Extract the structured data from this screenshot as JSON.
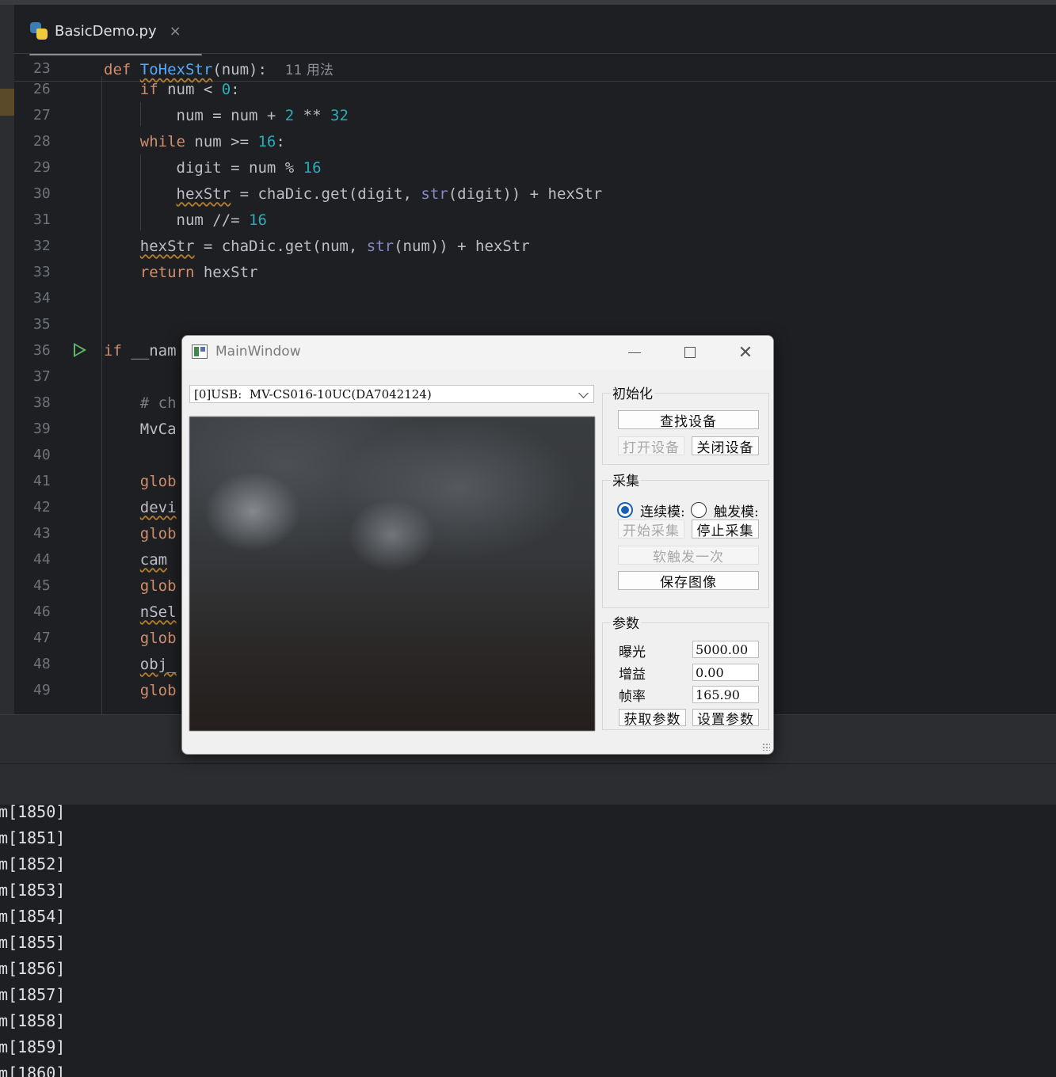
{
  "ide": {
    "tab_label": "BasicDemo.py",
    "tab_close": "×",
    "sticky_line": {
      "num": "23",
      "def": "def",
      "name": "ToHexStr",
      "rest": "(num):",
      "hint": "11 用法"
    },
    "code_lines": [
      {
        "num": "26",
        "tokens": [
          [
            "kw",
            "    if "
          ],
          [
            "plain",
            "num < "
          ],
          [
            "num",
            "0"
          ],
          [
            "plain",
            ":"
          ]
        ]
      },
      {
        "num": "27",
        "tokens": [
          [
            "plain",
            "        num = num + "
          ],
          [
            "num",
            "2"
          ],
          [
            "plain",
            " ** "
          ],
          [
            "num",
            "32"
          ]
        ]
      },
      {
        "num": "28",
        "tokens": [
          [
            "kw",
            "    while "
          ],
          [
            "plain",
            "num >= "
          ],
          [
            "num",
            "16"
          ],
          [
            "plain",
            ":"
          ]
        ]
      },
      {
        "num": "29",
        "tokens": [
          [
            "plain",
            "        digit = num % "
          ],
          [
            "num",
            "16"
          ]
        ]
      },
      {
        "num": "30",
        "tokens": [
          [
            "plain",
            "        "
          ],
          [
            "uw",
            "hexStr"
          ],
          [
            "plain",
            " = chaDic.get(digit, "
          ],
          [
            "bi",
            "str"
          ],
          [
            "plain",
            "(digit)) + hexStr"
          ]
        ]
      },
      {
        "num": "31",
        "tokens": [
          [
            "plain",
            "        num //= "
          ],
          [
            "num",
            "16"
          ]
        ]
      },
      {
        "num": "32",
        "tokens": [
          [
            "plain",
            "    "
          ],
          [
            "uw",
            "hexStr"
          ],
          [
            "plain",
            " = chaDic.get(num, "
          ],
          [
            "bi",
            "str"
          ],
          [
            "plain",
            "(num)) + hexStr"
          ]
        ]
      },
      {
        "num": "33",
        "tokens": [
          [
            "kw",
            "    return "
          ],
          [
            "plain",
            "hexStr"
          ]
        ]
      },
      {
        "num": "34",
        "tokens": []
      },
      {
        "num": "35",
        "tokens": []
      },
      {
        "num": "36",
        "tokens": [
          [
            "kw",
            "if "
          ],
          [
            "plain",
            "__nam"
          ]
        ]
      },
      {
        "num": "37",
        "tokens": []
      },
      {
        "num": "38",
        "tokens": [
          [
            "hintc",
            "    # ch"
          ]
        ]
      },
      {
        "num": "39",
        "tokens": [
          [
            "plain",
            "    MvCa"
          ]
        ]
      },
      {
        "num": "40",
        "tokens": []
      },
      {
        "num": "41",
        "tokens": [
          [
            "kw",
            "    glob"
          ]
        ]
      },
      {
        "num": "42",
        "tokens": [
          [
            "plain",
            "    "
          ],
          [
            "uw",
            "devi"
          ]
        ]
      },
      {
        "num": "43",
        "tokens": [
          [
            "kw",
            "    glob"
          ]
        ]
      },
      {
        "num": "44",
        "tokens": [
          [
            "plain",
            "    "
          ],
          [
            "uw",
            "cam"
          ]
        ]
      },
      {
        "num": "45",
        "tokens": [
          [
            "kw",
            "    glob"
          ]
        ]
      },
      {
        "num": "46",
        "tokens": [
          [
            "plain",
            "    "
          ],
          [
            "uw",
            "nSel"
          ]
        ]
      },
      {
        "num": "47",
        "tokens": [
          [
            "kw",
            "    glob"
          ]
        ]
      },
      {
        "num": "48",
        "tokens": [
          [
            "plain",
            "    "
          ],
          [
            "uw",
            "obj_"
          ]
        ]
      },
      {
        "num": "49",
        "tokens": [
          [
            "kw",
            "    glob"
          ]
        ]
      }
    ],
    "console_lines": [
      "m[1850]",
      "m[1851]",
      "m[1852]",
      "m[1853]",
      "m[1854]",
      "m[1855]",
      "m[1856]",
      "m[1857]",
      "m[1858]",
      "m[1859]",
      "m[1860]"
    ]
  },
  "qt": {
    "title": "MainWindow",
    "device_combo": "[0]USB:  MV-CS016-10UC(DA7042124)",
    "init_group": {
      "title": "初始化",
      "find": "查找设备",
      "open": "打开设备",
      "close": "关闭设备"
    },
    "acq_group": {
      "title": "采集",
      "continuous": "连续模:",
      "trigger": "触发模:",
      "start": "开始采集",
      "stop": "停止采集",
      "soft_trigger": "软触发一次",
      "save": "保存图像"
    },
    "param_group": {
      "title": "参数",
      "exposure_label": "曝光",
      "exposure_value": "5000.00",
      "gain_label": "增益",
      "gain_value": "0.00",
      "fps_label": "帧率",
      "fps_value": "165.90",
      "get": "获取参数",
      "set": "设置参数"
    }
  }
}
